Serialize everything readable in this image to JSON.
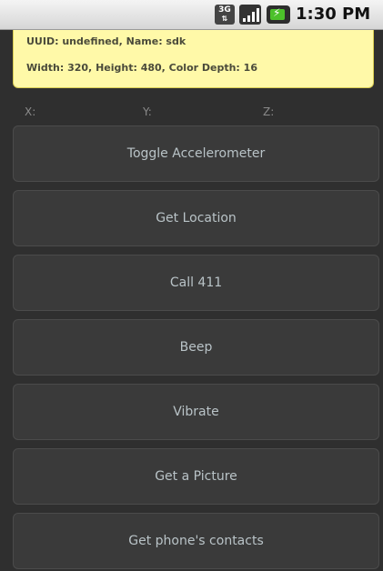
{
  "status_bar": {
    "network_label": "3G",
    "time": "1:30 PM",
    "icons": [
      "network-3g-icon",
      "signal-strength-icon",
      "battery-charging-icon"
    ]
  },
  "device_info": {
    "line1": "UUID: undefined, Name: sdk",
    "line2": "Width: 320, Height: 480, Color Depth: 16"
  },
  "accelerometer": {
    "x_label": "X:",
    "y_label": "Y:",
    "z_label": "Z:"
  },
  "buttons": [
    {
      "label": "Toggle Accelerometer"
    },
    {
      "label": "Get Location"
    },
    {
      "label": "Call 411"
    },
    {
      "label": "Beep"
    },
    {
      "label": "Vibrate"
    },
    {
      "label": "Get a Picture"
    },
    {
      "label": "Get phone's contacts"
    }
  ],
  "colors": {
    "background": "#2f2f2f",
    "info_box": "#fff9a8",
    "button_bg": "#3a3a3a",
    "button_text": "#b9c3c7",
    "battery_green": "#4cc12a"
  }
}
